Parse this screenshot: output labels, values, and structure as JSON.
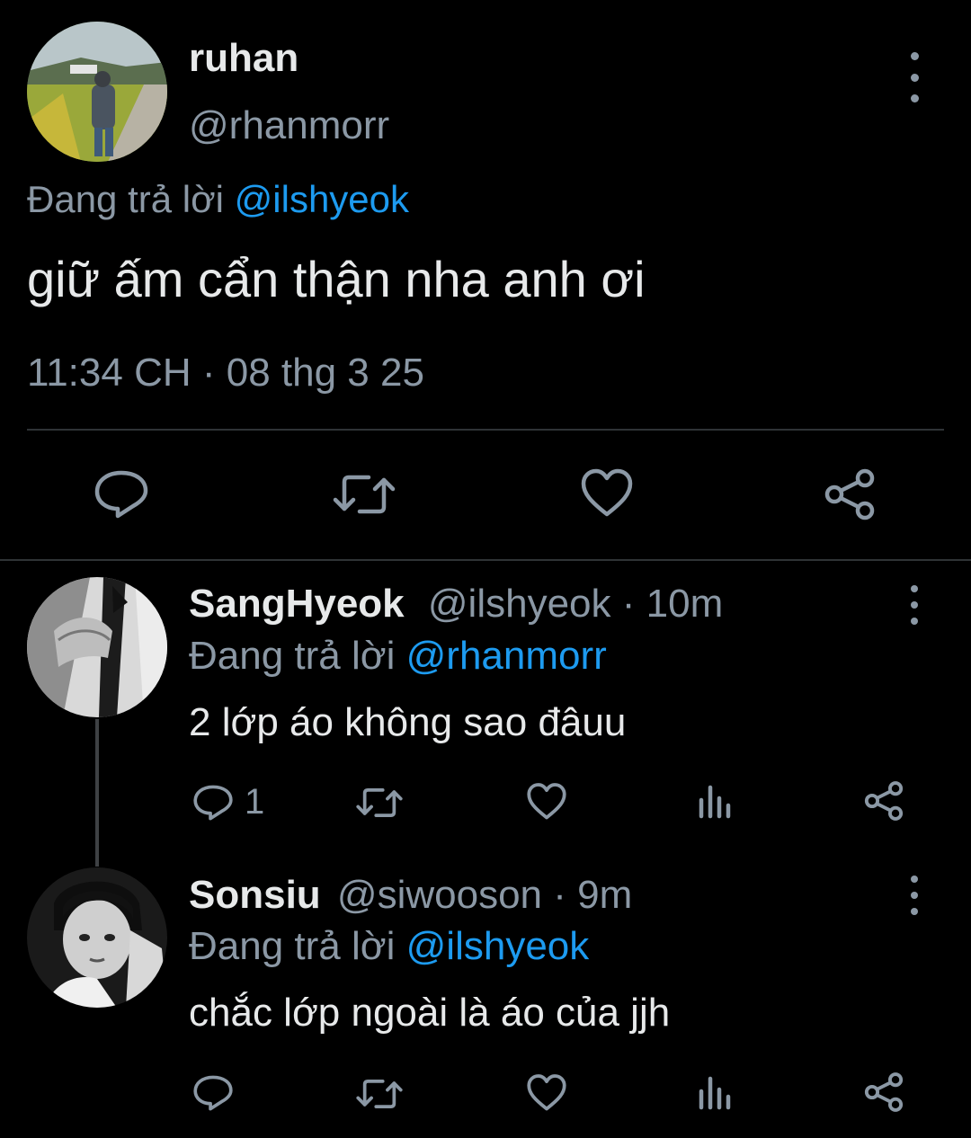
{
  "main_tweet": {
    "display_name": "ruhan",
    "handle": "@rhanmorr",
    "replying_prefix": "Đang trả lời",
    "replying_to": "@ilshyeok",
    "text": "giữ ấm cẩn thận nha anh ơi",
    "timestamp": "11:34 CH · 08 thg 3 25"
  },
  "replies": [
    {
      "display_name": "SangHyeok",
      "handle": "@ilshyeok",
      "time": "· 10m",
      "replying_prefix": "Đang trả lời",
      "replying_to": "@rhanmorr",
      "text": "2 lớp áo không sao đâuu",
      "reply_count": "1"
    },
    {
      "display_name": "Sonsiu",
      "handle": "@siwooson",
      "time": "· 9m",
      "replying_prefix": "Đang trả lời",
      "replying_to": "@ilshyeok",
      "text": "chắc lớp ngoài là áo của jjh"
    }
  ],
  "colors": {
    "background": "#000000",
    "text": "#e7e9ea",
    "muted": "#8b98a5",
    "link": "#1d9bf0",
    "divider": "#2f3336"
  },
  "icons": [
    "more-vertical-icon",
    "reply-icon",
    "retweet-icon",
    "like-icon",
    "share-icon",
    "views-icon"
  ]
}
